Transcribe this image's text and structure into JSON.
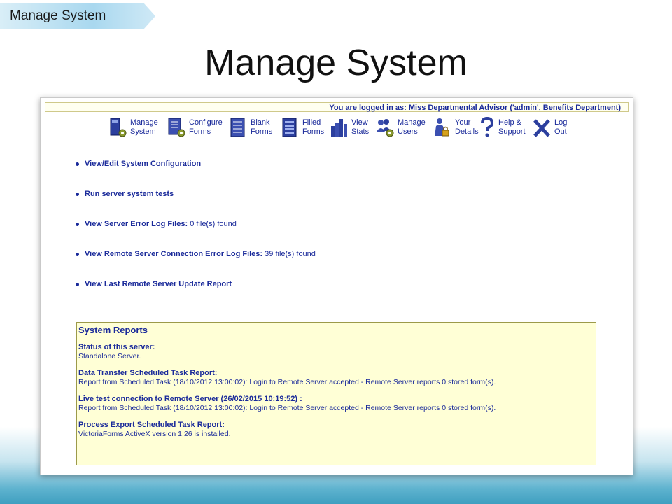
{
  "slide": {
    "breadcrumb": "Manage System",
    "title": "Manage System"
  },
  "app": {
    "login_status": "You are logged in as: Miss Departmental Advisor ('admin', Benefits Department)",
    "toolbar": [
      {
        "line1": "Manage",
        "line2": "System",
        "icon": "manage-system-icon"
      },
      {
        "line1": "Configure",
        "line2": "Forms",
        "icon": "configure-forms-icon"
      },
      {
        "line1": "Blank",
        "line2": "Forms",
        "icon": "blank-forms-icon"
      },
      {
        "line1": "Filled",
        "line2": "Forms",
        "icon": "filled-forms-icon"
      },
      {
        "line1": "View",
        "line2": "Stats",
        "icon": "stats-chart-icon"
      },
      {
        "line1": "Manage",
        "line2": "Users",
        "icon": "manage-users-icon"
      },
      {
        "line1": "Your",
        "line2": "Details",
        "icon": "user-lock-icon"
      },
      {
        "line1": "Help &",
        "line2": "Support",
        "icon": "question-mark-icon"
      },
      {
        "line1": "Log",
        "line2": "Out",
        "icon": "x-logout-icon"
      }
    ],
    "links": [
      {
        "label": "View/Edit System Configuration",
        "extra": ""
      },
      {
        "label": "Run server system tests",
        "extra": ""
      },
      {
        "label": "View Server Error Log Files:",
        "extra": " 0 file(s) found"
      },
      {
        "label": "View Remote Server Connection Error Log Files:",
        "extra": " 39 file(s) found"
      },
      {
        "label": "View Last Remote Server Update Report",
        "extra": ""
      }
    ],
    "reports": {
      "title": "System Reports",
      "sections": [
        {
          "heading": "Status of this server:",
          "body": "Standalone Server."
        },
        {
          "heading": "Data Transfer Scheduled Task Report:",
          "body": "Report from Scheduled Task (18/10/2012 13:00:02): Login to Remote Server accepted - Remote Server reports 0 stored form(s)."
        },
        {
          "heading": "Live test connection to Remote Server (26/02/2015 10:19:52) :",
          "body": "Report from Scheduled Task (18/10/2012 13:00:02): Login to Remote Server accepted - Remote Server reports 0 stored form(s)."
        },
        {
          "heading": "Process Export Scheduled Task Report:",
          "body": "VictoriaForms ActiveX version 1.26 is installed."
        }
      ]
    }
  }
}
